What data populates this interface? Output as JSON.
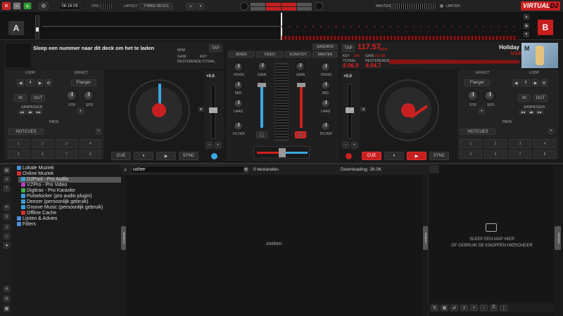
{
  "topbar": {
    "time": "06:16:09",
    "cpu_label": "CPU",
    "layout_label": "LAYOUT",
    "layout_value": "THREE DECKS",
    "master_label": "MASTER",
    "limiter_label": "LIMITER",
    "logo_virtual": "VIRTUAL",
    "logo_dj": "DJ"
  },
  "deck_a": {
    "letter": "A",
    "title": "Sleep een nummer naar dit deck om het te laden",
    "bpm_label": "BPM",
    "tap_label": "TAP",
    "gain_label": "GAIN",
    "key_label": "KEY",
    "remaining_label": "RESTERENDE",
    "total_label": "TOTAAL",
    "loop_label": "LOOP",
    "effect_label": "EFFECT",
    "loop_value": "4",
    "effect_value": "Flanger",
    "in_label": "IN",
    "out_label": "OUT",
    "shift_label": "AANPASSEN",
    "str_label": "STR",
    "spd_label": "SPD",
    "pads_label": "PADS",
    "hotcues_label": "HOTCUES",
    "pads": [
      "1",
      "2",
      "3",
      "4",
      "5",
      "6",
      "7",
      "8"
    ],
    "pitch_value": "+0.0",
    "cue_label": "CUE",
    "play_pause_label": "⏸",
    "play_label": "▶",
    "sync_label": "SYNC"
  },
  "deck_b": {
    "letter": "B",
    "title": "Holiday",
    "artist": "Madonna",
    "bpm_value": "117.57",
    "bpm_label": "BPM",
    "tap_label": "TAP",
    "key_label": "KEY",
    "key_value": "10A",
    "gain_label": "GAIN",
    "gain_value": "0.0 dB",
    "total_label": "TOTAAL",
    "total_value": "4:06.9",
    "remaining_label": "RESTERENDE",
    "remaining_value": "4:04.7",
    "loop_label": "LOOP",
    "effect_label": "EFFECT",
    "loop_value": "4",
    "effect_value": "Flanger",
    "in_label": "IN",
    "out_label": "OUT",
    "shift_label": "AANPASSEN",
    "str_label": "STR",
    "spd_label": "SPD",
    "pads_label": "PADS",
    "hotcues_label": "HOTCUES",
    "pads": [
      "1",
      "2",
      "3",
      "4",
      "5",
      "6",
      "7",
      "8"
    ],
    "pitch_value": "+0.0",
    "cue_label": "CUE",
    "play_pause_label": "⏸",
    "play_label": "▶",
    "sync_label": "SYNC"
  },
  "mixer": {
    "tabs": [
      "MIXER",
      "VIDEO",
      "SCRATCH",
      "MASTER"
    ],
    "sandbox_label": "SANDBOX",
    "gain": "GAIN",
    "high": "HOOG",
    "mid": "MID",
    "low": "LAAG",
    "filter": "FILTER"
  },
  "browser": {
    "tree": [
      {
        "label": "Lokale Muziek",
        "color": "#4a90d9",
        "indent": 0
      },
      {
        "label": "Online Muziek",
        "color": "#d03030",
        "indent": 0
      },
      {
        "label": "DJPool - Pro Audio",
        "color": "#3aa0d8",
        "indent": 1,
        "selected": true
      },
      {
        "label": "VJ'Pro - Pro Video",
        "color": "#b040c0",
        "indent": 1
      },
      {
        "label": "Digitrax - Pro Karaoke",
        "color": "#40b040",
        "indent": 1
      },
      {
        "label": "Pulselocker (pro audio plugin)",
        "color": "#3aa0d8",
        "indent": 1
      },
      {
        "label": "Deezer (persoonlijk gebruik)",
        "color": "#3aa0d8",
        "indent": 1
      },
      {
        "label": "Groove Music (persoonlijk gebruik)",
        "color": "#3aa0d8",
        "indent": 1
      },
      {
        "label": "Offline Cache",
        "color": "#d03030",
        "indent": 1
      },
      {
        "label": "Lijsten & Advies",
        "color": "#4a90d9",
        "indent": 0
      },
      {
        "label": "Filters",
        "color": "#4a90d9",
        "indent": 0
      }
    ],
    "search_value": "usher",
    "file_count": "0 bestanden",
    "downloading": "Downloading: 26.0K",
    "center_text": "zoeken",
    "sidebar_tab": "Bladeren",
    "right_tab": "Sideview",
    "right_tab2": "Samples",
    "empty_line1": "SLEEP EEN MAP HIER",
    "empty_line2": "OF GEBRUIK DE KNOPPEN HIERONDER"
  }
}
